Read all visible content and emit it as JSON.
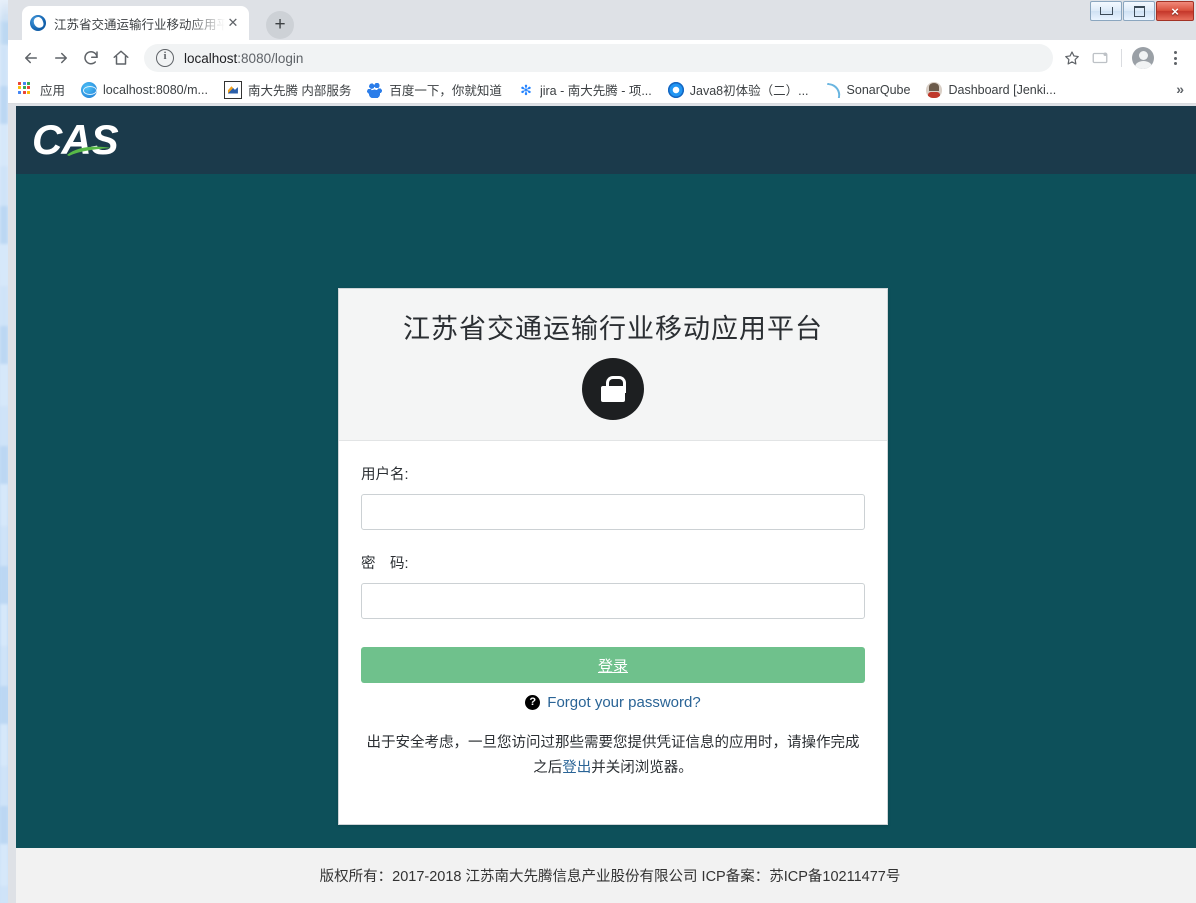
{
  "window": {
    "minimize_label": "Minimize",
    "restore_label": "Restore",
    "close_label": "×"
  },
  "browser": {
    "tab": {
      "title": "江苏省交通运输行业移动应用平台",
      "close_label": "✕",
      "favicon": "jiangsu-transport-favicon"
    },
    "new_tab_label": "+",
    "nav": {
      "back_label": "←",
      "forward_label": "→",
      "reload_label": "⟳",
      "home_label": "⌂"
    },
    "omnibox": {
      "info_label": "i",
      "host": "localhost",
      "path": ":8080/login",
      "full_url": "localhost:8080/login",
      "star_label": "☆"
    },
    "toolbar": {
      "cast_label": "cast-icon",
      "profile_label": "profile-avatar",
      "menu_label": "⋮"
    },
    "bookmarks": [
      {
        "label": "应用",
        "icon": "apps-grid-icon"
      },
      {
        "label": "localhost:8080/m...",
        "icon": "globe-icon"
      },
      {
        "label": "南大先腾 内部服务",
        "icon": "nanda-xianteng-icon"
      },
      {
        "label": "百度一下，你就知道",
        "icon": "baidu-paw-icon"
      },
      {
        "label": "jira - 南大先腾 - 项...",
        "icon": "jira-icon"
      },
      {
        "label": "Java8初体验（二）...",
        "icon": "java-icon"
      },
      {
        "label": "SonarQube",
        "icon": "sonarqube-icon"
      },
      {
        "label": "Dashboard [Jenki...",
        "icon": "jenkins-icon"
      }
    ],
    "bookmarks_overflow_label": "»"
  },
  "page": {
    "brand": {
      "logo_text": "CAS"
    },
    "card": {
      "title": "江苏省交通运输行业移动应用平台",
      "lock_icon": "padlock-icon",
      "username_label": "用户名:",
      "username_value": "",
      "username_placeholder": "",
      "password_label": "密　码:",
      "password_value": "",
      "password_placeholder": "",
      "submit_label": "登录",
      "forgot_icon": "?",
      "forgot_label": "Forgot your password?",
      "notice_before": "出于安全考虑，一旦您访问过那些需要您提供凭证信息的应用时，请操作完成之后",
      "notice_link": "登出",
      "notice_after": "并关闭浏览器。"
    },
    "footer": {
      "text": "版权所有：2017-2018 江苏南大先腾信息产业股份有限公司 ICP备案：苏ICP备10211477号"
    },
    "colors": {
      "background": "#0d505a",
      "header": "#1b3a4b",
      "accent_green": "#6fc18c",
      "link": "#2a6496",
      "footer_bg": "#f2f2f2"
    }
  }
}
